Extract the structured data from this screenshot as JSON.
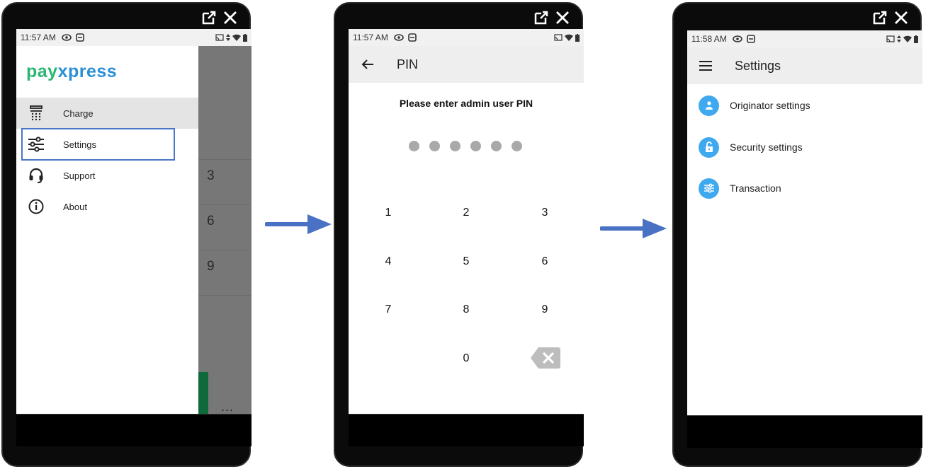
{
  "phone1": {
    "status_time": "11:57 AM",
    "logo_pay": "pay",
    "logo_xpress": "xpress",
    "menu": [
      {
        "label": "Charge",
        "icon": "calculator-icon"
      },
      {
        "label": "Settings",
        "icon": "sliders-icon"
      },
      {
        "label": "Support",
        "icon": "headset-icon"
      },
      {
        "label": "About",
        "icon": "info-icon"
      }
    ],
    "background_keys": [
      "3",
      "6",
      "9"
    ],
    "more_label": "..."
  },
  "phone2": {
    "status_time": "11:57 AM",
    "title": "PIN",
    "prompt": "Please enter admin user PIN",
    "pin_length_slots": 6,
    "keys": [
      "1",
      "2",
      "3",
      "4",
      "5",
      "6",
      "7",
      "8",
      "9",
      "0"
    ]
  },
  "phone3": {
    "status_time": "11:58 AM",
    "title": "Settings",
    "items": [
      {
        "label": "Originator settings",
        "icon": "person-icon"
      },
      {
        "label": "Security settings",
        "icon": "unlock-icon"
      },
      {
        "label": "Transaction",
        "icon": "sliders-icon"
      }
    ]
  },
  "colors": {
    "accent_blue": "#3fa9ef",
    "highlight_border": "#4a76c9",
    "arrow": "#4a72c4",
    "logo_green": "#2bb673",
    "logo_blue": "#2a8fd6"
  }
}
